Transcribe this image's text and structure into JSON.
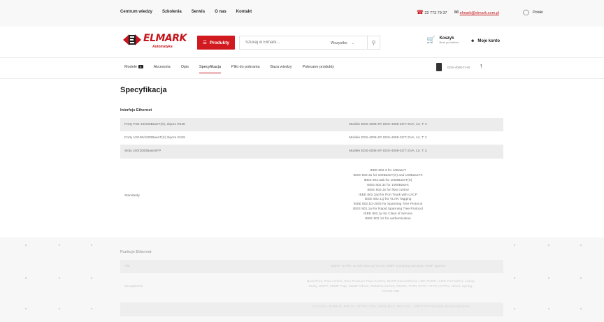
{
  "topbar": {
    "nav": [
      "Centrum wiedzy",
      "Szkolenia",
      "Serwis",
      "O nas",
      "Kontakt"
    ],
    "phone": "22 773 79 37",
    "email": "elmark@elmark.com.pl",
    "language": "Polski",
    "icons": {
      "phone": "phone-icon",
      "mail": "mail-icon",
      "globe": "globe-icon"
    }
  },
  "header": {
    "logo_name": "ELMARK",
    "logo_sub": "Automatyka",
    "products_label": "Produkty",
    "search_placeholder": "Szukaj w Elmark...",
    "search_scope": "Wszystko",
    "cart_title": "Koszyk",
    "cart_sub": "Brak produktów",
    "account_label": "Moje konto",
    "brand_color": "#c4161c"
  },
  "tabs": {
    "items": [
      {
        "label": "Modele",
        "badge": "4",
        "active": false
      },
      {
        "label": "Akcesoria",
        "active": false
      },
      {
        "label": "Opis",
        "active": false
      },
      {
        "label": "Specyfikacja",
        "active": true
      },
      {
        "label": "Pliki do pobrania",
        "active": false
      },
      {
        "label": "Baza wiedzy",
        "active": false
      },
      {
        "label": "Polecane produkty",
        "active": false
      }
    ],
    "product_code": "EDS-4008-T-HS"
  },
  "page_title": "Specyfikacja",
  "sections": [
    {
      "title": "Interfejs Ethernet",
      "rows": [
        {
          "key": "Porty PoE 10/100BaseT(X), złącze RJ45",
          "value": "Modele EDS-4008-4P, EDS-4008-2GT: EVA, LV, T: 4"
        },
        {
          "key": "Porty 10/100/1000BaseT(X) złącze RJ45",
          "value": "Modele EDS-4008-4P, EDS-4008-2GT: EVA, LV, T: 2"
        },
        {
          "key": "Sloty 100/1000BaseSFP",
          "value": "Modele EDS-4008-4P, EDS-4008-2GT: EVA, LV, T: 2"
        },
        {
          "key": "Standardy",
          "values": [
            "IEEE 802.3 for 10BaseT",
            "IEEE 802.3u for 100BaseT(X) and 100BaseFX",
            "IEEE 802.3ab for 1000BaseT(X)",
            "IEEE 802.3z for 1000BaseX",
            "IEEE 802.3x for flow control",
            "IEEE 802.3ad for Port Trunk with LACP",
            "IEEE 802.1Q for VLAN Tagging",
            "IEEE 802.1D-2004 for Spanning Tree Protocol",
            "IEEE 802.1w for Rapid Spanning Tree Protocol",
            "IEEE 802.1p for Class of Service",
            "IEEE 802.1X for authentication"
          ]
        }
      ]
    },
    {
      "title": "Funkcje Ethernet",
      "rows": [
        {
          "key": "Filtr",
          "value": "GMRP, GVRP, GARP, 802.1Q VLAN, IGMP Snooping v1/v2/v3, IGMP Querier"
        },
        {
          "key": "Zarządzanie",
          "value": "Back Pres, Flow control, Zero Pressure Flow Control, DHCP Server/Client, ARP, RARP, LLDP, Port Mirror, Linkup Delay, SMTP, SNMP Trap, SNMP Inform, SNMPv1/v2c/v3, RMON, TFTP, SFTP, HTTP, HTTPS, Telnet, Syslog, Private MIB"
        },
        {
          "key": "",
          "value": "TACACS+, RADIUS, 802.1X, HTTPS, SSH, Sticky MAC, MAC ACL, SMTP, Port Security, Broadcast storm"
        }
      ]
    }
  ]
}
